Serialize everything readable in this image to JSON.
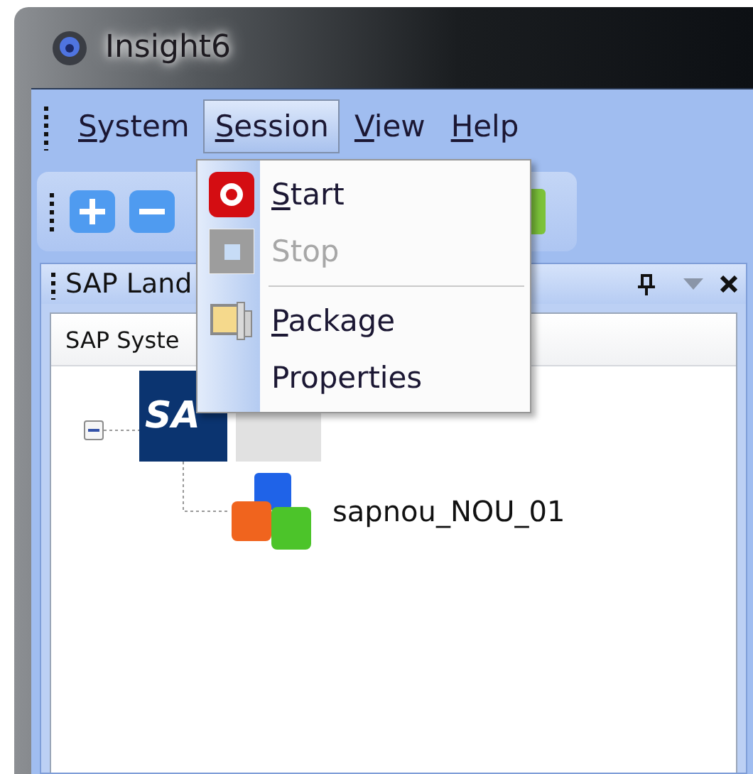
{
  "window": {
    "title": "Insight6"
  },
  "menu_bar": [
    {
      "label": "System",
      "selected": false,
      "access_key": true
    },
    {
      "label": "Session",
      "selected": true,
      "access_key": true
    },
    {
      "label": "View",
      "selected": false,
      "access_key": true
    },
    {
      "label": "Help",
      "selected": false,
      "access_key": true
    }
  ],
  "session_menu": [
    {
      "kind": "item",
      "label": "Start",
      "disabled": false,
      "access_key": true
    },
    {
      "kind": "item",
      "label": "Stop",
      "disabled": true,
      "access_key": false
    },
    {
      "kind": "separator"
    },
    {
      "kind": "item",
      "label": "Package",
      "disabled": false,
      "access_key": true
    },
    {
      "kind": "item",
      "label": "Properties",
      "disabled": false,
      "access_key": false
    }
  ],
  "panel": {
    "title": "SAP Land",
    "column_header": "SAP Syste",
    "tree": [
      {
        "logo": "SA",
        "expanded": true,
        "children": [
          {
            "label": "sapnou_NOU_01"
          }
        ]
      }
    ]
  }
}
